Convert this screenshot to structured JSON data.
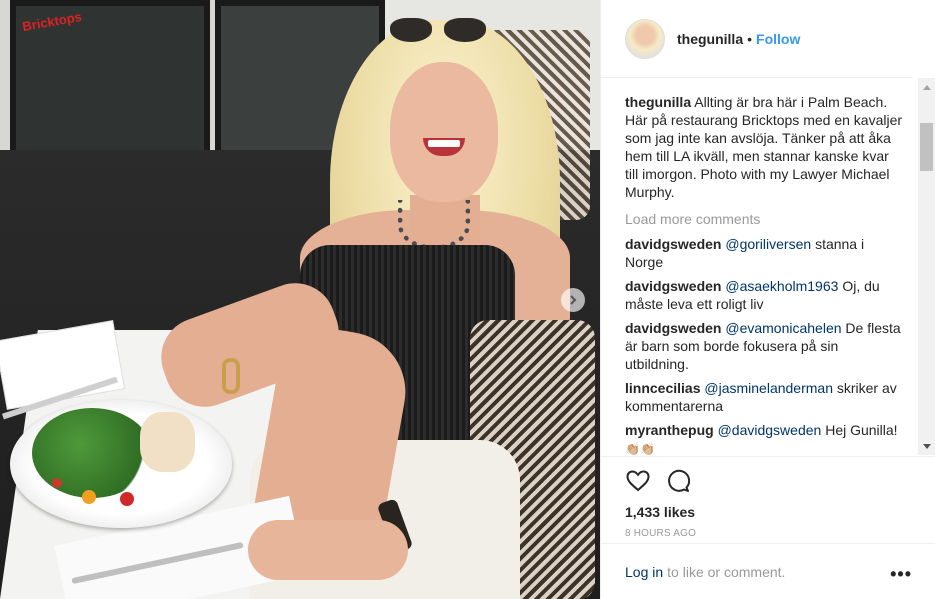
{
  "post": {
    "username": "thegunilla",
    "separator": "•",
    "follow_label": "Follow",
    "caption": {
      "username": "thegunilla",
      "text": "Allting är bra här i Palm Beach. Här på restaurang Bricktops med en kavaljer som jag inte kan avslöja. Tänker på att åka hem till LA ikväll, men stannar kanske kvar till imorgon. Photo with my Lawyer Michael Murphy."
    },
    "load_more": "Load more comments",
    "comments": [
      {
        "username": "davidgsweden",
        "mention": "@goriliversen",
        "text": "stanna i Norge"
      },
      {
        "username": "davidgsweden",
        "mention": "@asaekholm1963",
        "text": "Oj, du måste leva ett roligt liv"
      },
      {
        "username": "davidgsweden",
        "mention": "@evamonicahelen",
        "text": "De flesta är barn som borde fokusera på sin utbildning."
      },
      {
        "username": "linncecilias",
        "mention": "@jasminelanderman",
        "text": "skriker av kommentarerna"
      },
      {
        "username": "myranthepug",
        "mention": "@davidgsweden",
        "text": "Hej Gunilla!",
        "emoji": "👏🏼👏🏼"
      }
    ],
    "likes": "1,433 likes",
    "time": "8 HOURS AGO",
    "login_link": "Log in",
    "login_rest": "to like or comment.",
    "more_label": "•••",
    "photo": {
      "menu_card_text": "Bricktops"
    }
  },
  "icons": [
    "heart-icon",
    "comment-icon",
    "chevron-right-icon",
    "more-options-icon"
  ],
  "colors": {
    "link": "#3897f0",
    "mention": "#003569",
    "muted": "#999999"
  }
}
